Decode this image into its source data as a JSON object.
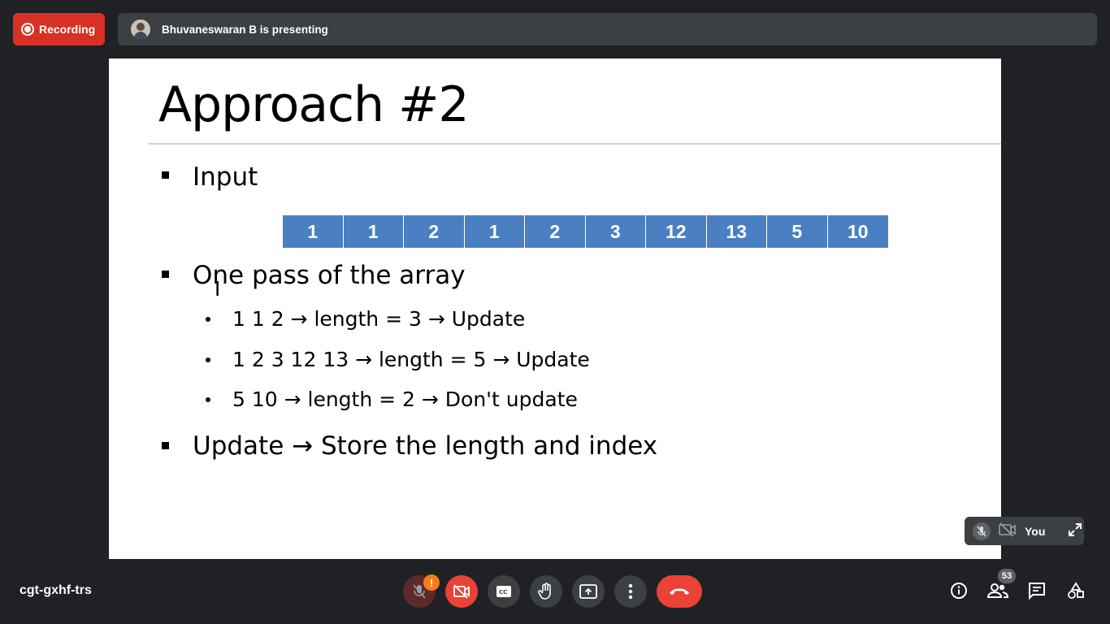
{
  "recording": {
    "label": "Recording"
  },
  "presenter": {
    "text": "Bhuvaneswaran B is presenting"
  },
  "slide": {
    "title": "Approach #2",
    "bullets": [
      {
        "text": "Input"
      },
      {
        "text": "One pass of the array"
      },
      {
        "text": "Update → Store the length and index"
      }
    ],
    "array": [
      "1",
      "1",
      "2",
      "1",
      "2",
      "3",
      "12",
      "13",
      "5",
      "10"
    ],
    "sub_bullets": [
      "1 1 2 → length = 3 → Update",
      "1 2 3 12 13  → length = 5 → Update",
      "5 10  → length = 2 → Don't update"
    ]
  },
  "self_view": {
    "label": "You"
  },
  "meeting": {
    "code": "cgt-gxhf-trs"
  },
  "mic_warning": "!",
  "participants": {
    "count": "53"
  },
  "colors": {
    "recording": "#d93025",
    "array_cell": "#4a7fc1",
    "leave": "#ea4335",
    "bar": "#202124"
  }
}
